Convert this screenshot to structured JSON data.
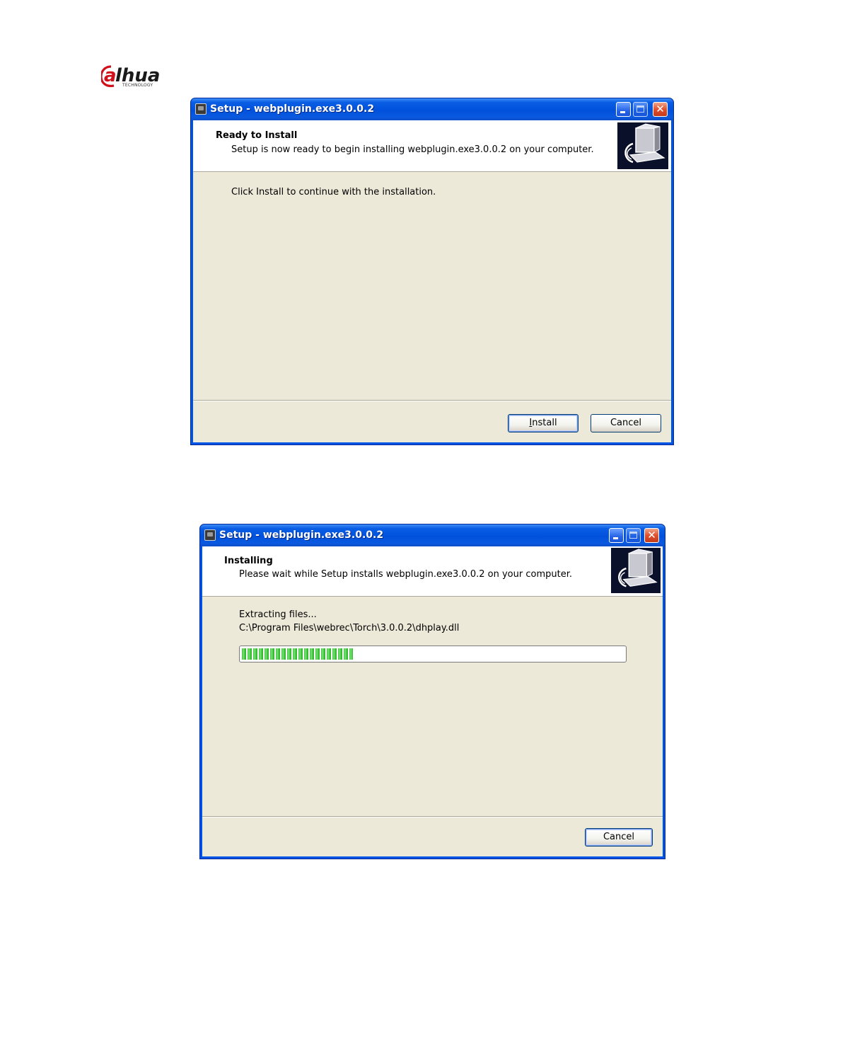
{
  "brand": {
    "logo_text": "alhua",
    "logo_subtext": "TECHNOLOGY",
    "logo_color": "#d0101a"
  },
  "colors": {
    "titlebar": "#0054e3",
    "dialog_bg": "#ece9d8",
    "progress": "#2fb82c",
    "close_button": "#e0502f"
  },
  "dialog1": {
    "title": "Setup - webplugin.exe3.0.0.2",
    "icons": [
      "setup-window-icon",
      "minimize-icon",
      "maximize-icon",
      "close-icon",
      "setup-computer-icon"
    ],
    "header_title": "Ready to Install",
    "header_subtitle": "Setup is now ready to begin installing webplugin.exe3.0.0.2 on your computer.",
    "body_text": "Click Install to continue with the installation.",
    "install_label": "Install",
    "install_underline": "I",
    "install_rest": "nstall",
    "cancel_label": "Cancel"
  },
  "dialog2": {
    "title": "Setup - webplugin.exe3.0.0.2",
    "icons": [
      "setup-window-icon",
      "minimize-icon",
      "maximize-icon",
      "close-icon",
      "setup-computer-icon"
    ],
    "header_title": "Installing",
    "header_subtitle": "Please wait while Setup installs webplugin.exe3.0.0.2 on your computer.",
    "status_text": "Extracting files...",
    "file_path": "C:\\Program Files\\webrec\\Torch\\3.0.0.2\\dhplay.dll",
    "progress_fraction": 0.29,
    "cancel_label": "Cancel"
  }
}
